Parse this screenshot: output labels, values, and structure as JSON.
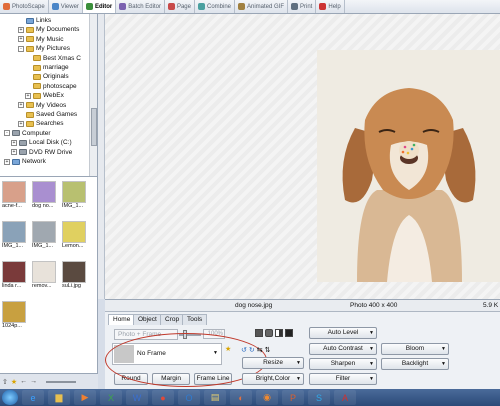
{
  "tabs": [
    {
      "label": "PhotoScape",
      "color": "#e06b3a",
      "active": false
    },
    {
      "label": "Viewer",
      "color": "#4a86c8",
      "active": false
    },
    {
      "label": "Editor",
      "color": "#3b8f3b",
      "active": true
    },
    {
      "label": "Batch Editor",
      "color": "#7b61b0",
      "active": false
    },
    {
      "label": "Page",
      "color": "#c84a4a",
      "active": false
    },
    {
      "label": "Combine",
      "color": "#4aa0a0",
      "active": false
    },
    {
      "label": "Animated GIF",
      "color": "#a08040",
      "active": false
    },
    {
      "label": "Print",
      "color": "#607080",
      "active": false
    },
    {
      "label": "Help",
      "color": "#cc3333",
      "active": false
    }
  ],
  "tree": [
    {
      "label": "Links",
      "indent": 2,
      "exp": "",
      "icon": "blue"
    },
    {
      "label": "My Documents",
      "indent": 2,
      "exp": "+",
      "icon": "yellow"
    },
    {
      "label": "My Music",
      "indent": 2,
      "exp": "+",
      "icon": "yellow"
    },
    {
      "label": "My Pictures",
      "indent": 2,
      "exp": "-",
      "icon": "yellow"
    },
    {
      "label": "Best Xmas C",
      "indent": 3,
      "exp": "",
      "icon": "yellow"
    },
    {
      "label": "marriage",
      "indent": 3,
      "exp": "",
      "icon": "yellow"
    },
    {
      "label": "Originals",
      "indent": 3,
      "exp": "",
      "icon": "yellow"
    },
    {
      "label": "photoscape",
      "indent": 3,
      "exp": "",
      "icon": "yellow"
    },
    {
      "label": "WebEx",
      "indent": 3,
      "exp": "+",
      "icon": "yellow"
    },
    {
      "label": "My Videos",
      "indent": 2,
      "exp": "+",
      "icon": "yellow"
    },
    {
      "label": "Saved Games",
      "indent": 2,
      "exp": "",
      "icon": "yellow"
    },
    {
      "label": "Searches",
      "indent": 2,
      "exp": "+",
      "icon": "yellow"
    },
    {
      "label": "Computer",
      "indent": 0,
      "exp": "-",
      "icon": "gray"
    },
    {
      "label": "Local Disk (C:)",
      "indent": 1,
      "exp": "+",
      "icon": "gray"
    },
    {
      "label": "DVD RW Drive",
      "indent": 1,
      "exp": "+",
      "icon": "gray"
    },
    {
      "label": "Network",
      "indent": 0,
      "exp": "+",
      "icon": "blue"
    }
  ],
  "thumbnails": [
    {
      "caption": "acne-f...",
      "color": "#d8a08a"
    },
    {
      "caption": "dog no...",
      "color": "#a98fd0"
    },
    {
      "caption": "IMG_1...",
      "color": "#b8c070"
    },
    {
      "caption": "IMG_1...",
      "color": "#8aa2b8"
    },
    {
      "caption": "IMG_1...",
      "color": "#a0a8b0"
    },
    {
      "caption": "Lemon...",
      "color": "#e0d060"
    },
    {
      "caption": "linda r...",
      "color": "#7a3a3a"
    },
    {
      "caption": "remov...",
      "color": "#e8e2da"
    },
    {
      "caption": "suLi.jpg",
      "color": "#5a4a40"
    },
    {
      "caption": "1024p...",
      "color": "#c8a040"
    }
  ],
  "status": {
    "filename": "dog nose.jpg",
    "dimensions": "Photo 400 x 400",
    "filesize": "5.9 K"
  },
  "editor": {
    "tabs": [
      "Home",
      "Object",
      "Crop",
      "Tools"
    ],
    "active_tab": "Home",
    "photo_frame_placeholder": "Photo + Frame",
    "percent": "100%",
    "frame_value": "No Frame",
    "buttons": {
      "round": "Round",
      "margin": "Margin",
      "frame_line": "Frame Line",
      "resize": "Resize",
      "bright_color": "Bright,Color",
      "auto_level": "Auto Level",
      "auto_contrast": "Auto Contrast",
      "sharpen": "Sharpen",
      "filter": "Filter",
      "bloom": "Bloom",
      "backlight": "Backlight"
    }
  },
  "taskbar_apps": [
    {
      "name": "ie-icon",
      "glyph": "e",
      "color": "#3aa0ff"
    },
    {
      "name": "folder-icon",
      "glyph": "▆",
      "color": "#e8c050"
    },
    {
      "name": "media-icon",
      "glyph": "▶",
      "color": "#f08030"
    },
    {
      "name": "excel-icon",
      "glyph": "X",
      "color": "#3fa34d"
    },
    {
      "name": "word-icon",
      "glyph": "W",
      "color": "#3a6fd0"
    },
    {
      "name": "chrome-icon",
      "glyph": "●",
      "color": "#e04a3a"
    },
    {
      "name": "outlook-icon",
      "glyph": "O",
      "color": "#2f7bd0"
    },
    {
      "name": "notes-icon",
      "glyph": "▤",
      "color": "#e8d070"
    },
    {
      "name": "photoscape-icon",
      "glyph": "◐",
      "color": "#e07040"
    },
    {
      "name": "firefox-icon",
      "glyph": "◉",
      "color": "#f08a30"
    },
    {
      "name": "ppt-icon",
      "glyph": "P",
      "color": "#d9602f"
    },
    {
      "name": "skype-icon",
      "glyph": "S",
      "color": "#30a8e8"
    },
    {
      "name": "acrobat-icon",
      "glyph": "A",
      "color": "#d03030"
    }
  ]
}
